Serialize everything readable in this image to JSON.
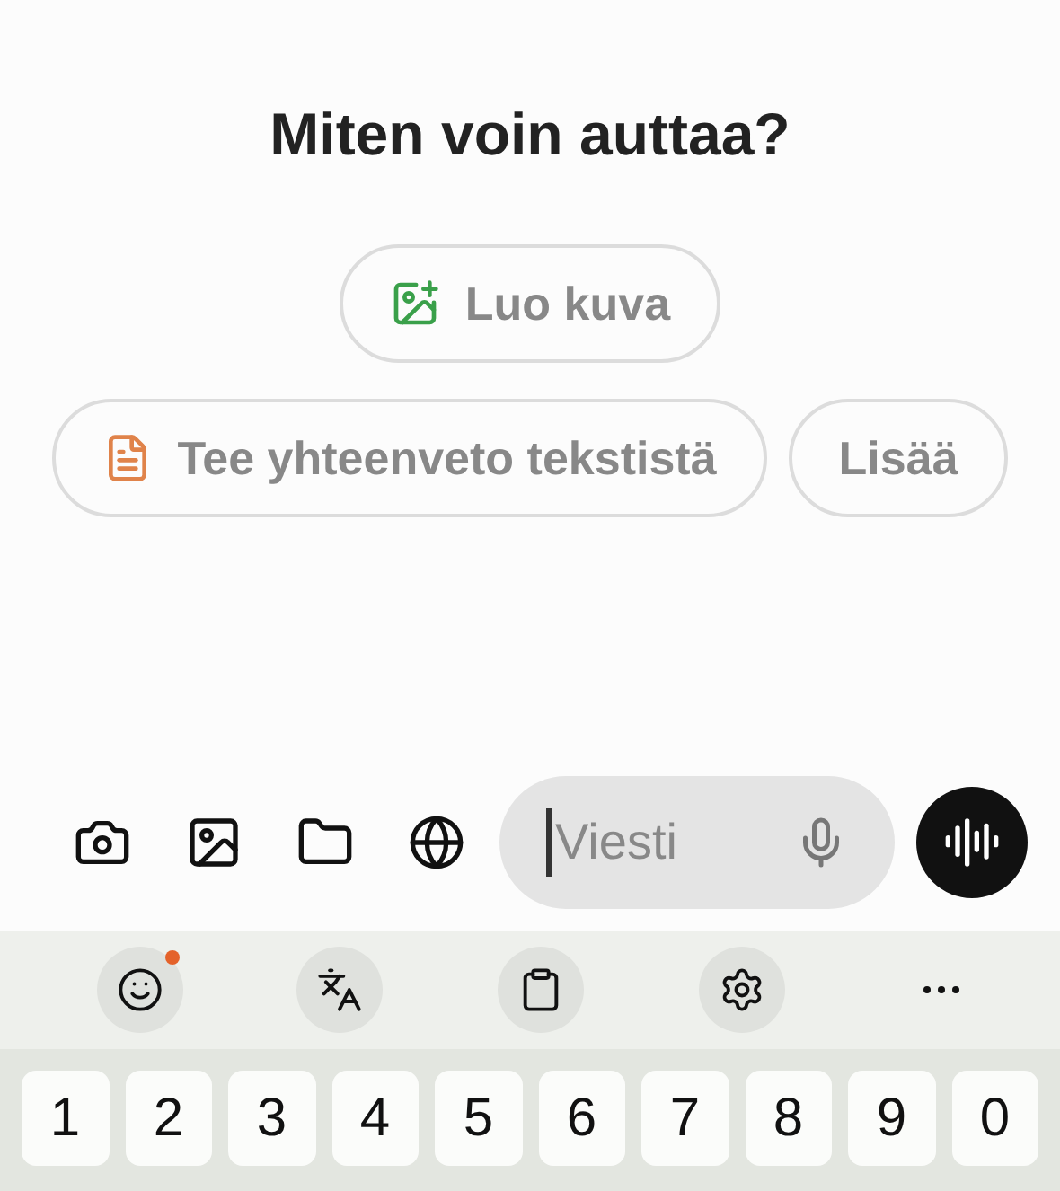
{
  "heading": "Miten voin auttaa?",
  "suggestions": [
    [
      {
        "label": "Luo kuva",
        "kind": "image"
      }
    ],
    [
      {
        "label": "Tee yhteenveto tekstistä",
        "kind": "document"
      },
      {
        "label": "Lisää",
        "kind": "plain"
      }
    ]
  ],
  "attachments": [
    {
      "kind": "camera"
    },
    {
      "kind": "gallery"
    },
    {
      "kind": "folder"
    },
    {
      "kind": "globe"
    }
  ],
  "message": {
    "placeholder": "Viesti",
    "focused": true
  },
  "keyboard_tools": [
    {
      "kind": "emoji",
      "badge": true
    },
    {
      "kind": "translate",
      "badge": false
    },
    {
      "kind": "clipboard",
      "badge": false
    },
    {
      "kind": "settings",
      "badge": false
    },
    {
      "kind": "more",
      "badge": false
    }
  ],
  "number_keys": [
    "1",
    "2",
    "3",
    "4",
    "5",
    "6",
    "7",
    "8",
    "9",
    "0"
  ]
}
